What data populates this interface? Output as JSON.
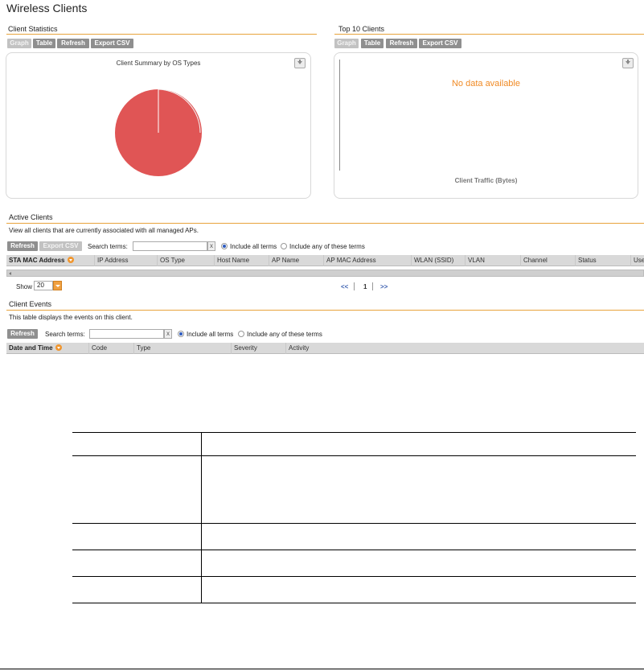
{
  "page": {
    "title": "Wireless Clients"
  },
  "client_statistics": {
    "title": "Client Statistics",
    "buttons": {
      "graph": "Graph",
      "table": "Table",
      "refresh": "Refresh",
      "export": "Export CSV"
    },
    "chart": {
      "title": "Client Summary by OS Types",
      "download_icon": "download-icon"
    }
  },
  "top_clients": {
    "title": "Top 10 Clients",
    "buttons": {
      "graph": "Graph",
      "table": "Table",
      "refresh": "Refresh",
      "export": "Export CSV"
    },
    "chart": {
      "no_data": "No data available",
      "xlabel": "Client Traffic (Bytes)",
      "download_icon": "download-icon"
    }
  },
  "active_clients": {
    "title": "Active Clients",
    "description": "View all clients that are currently associated with all managed APs.",
    "buttons": {
      "refresh": "Refresh",
      "export": "Export CSV"
    },
    "search": {
      "label": "Search terms:",
      "value": "",
      "clear": "x"
    },
    "options": {
      "all_terms": "Include all terms",
      "any_terms": "Include any of these terms",
      "selected": "all"
    },
    "columns": [
      "STA MAC Address",
      "IP Address",
      "OS Type",
      "Host Name",
      "AP Name",
      "AP MAC Address",
      "WLAN (SSID)",
      "VLAN",
      "Channel",
      "Status",
      "Use"
    ],
    "show": {
      "label": "Show",
      "value": "20"
    },
    "pager": {
      "prev": "<<",
      "page": "1",
      "next": ">>"
    }
  },
  "client_events": {
    "title": "Client Events",
    "description": "This table displays the events on this client.",
    "buttons": {
      "refresh": "Refresh"
    },
    "search": {
      "label": "Search terms:",
      "value": "",
      "clear": "x"
    },
    "options": {
      "all_terms": "Include all terms",
      "any_terms": "Include any of these terms",
      "selected": "all"
    },
    "columns": [
      "Date and Time",
      "Code",
      "Type",
      "Severity",
      "Activity"
    ]
  },
  "chart_data": {
    "type": "pie",
    "title": "Client Summary by OS Types",
    "values": [
      100
    ],
    "colors": [
      "#e05555"
    ]
  }
}
